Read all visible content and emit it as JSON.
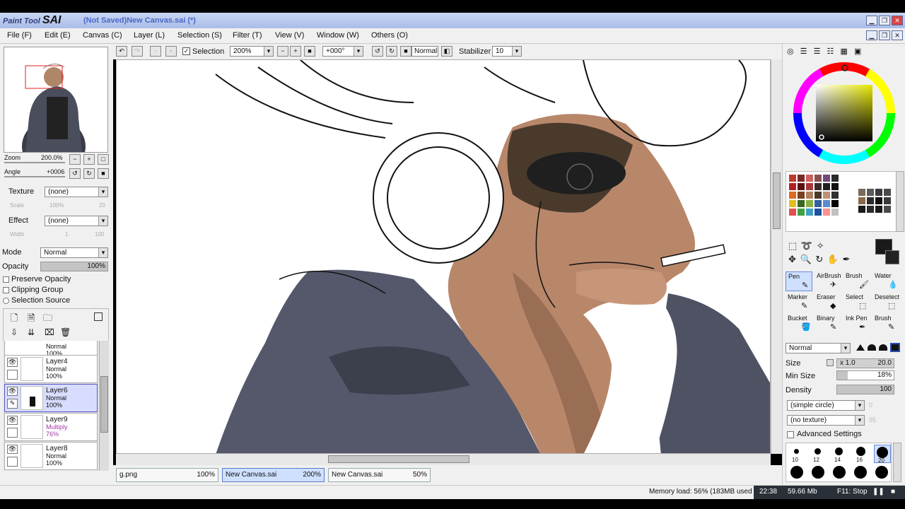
{
  "titlebar": {
    "logo_small": "Paint Tool",
    "logo_big": "SAI",
    "title": "(Not Saved)New Canvas.sai (*)"
  },
  "menu": [
    "File (F)",
    "Edit (E)",
    "Canvas (C)",
    "Layer (L)",
    "Selection (S)",
    "Filter (T)",
    "View (V)",
    "Window (W)",
    "Others (O)"
  ],
  "toolbar": {
    "selection_label": "Selection",
    "zoom": "200%",
    "angle": "+000°",
    "mode": "Normal",
    "stabilizer_label": "Stabilizer",
    "stabilizer_value": "10"
  },
  "navigator": {
    "zoom_label": "Zoom",
    "zoom_value": "200.0%",
    "angle_label": "Angle",
    "angle_value": "+0006"
  },
  "layer_props": {
    "texture_label": "Texture",
    "texture_value": "(none)",
    "scale_label": "Scale",
    "scale_value": "100%",
    "scale_num": "20",
    "effect_label": "Effect",
    "effect_value": "(none)",
    "width_label": "Width",
    "width_value": "1",
    "width_num": "100",
    "mode_label": "Mode",
    "mode_value": "Normal",
    "opacity_label": "Opacity",
    "opacity_value": "100%",
    "preserve_opacity": "Preserve Opacity",
    "clipping_group": "Clipping Group",
    "selection_source": "Selection Source"
  },
  "layers": [
    {
      "name": "Layer4",
      "mode": "Normal",
      "opacity": "100%",
      "active": false
    },
    {
      "name": "Layer6",
      "mode": "Normal",
      "opacity": "100%",
      "active": true
    },
    {
      "name": "Layer9",
      "mode": "Multiply",
      "opacity": "76%",
      "active": false
    },
    {
      "name": "Layer8",
      "mode": "Normal",
      "opacity": "100%",
      "active": false
    }
  ],
  "layer_top_partial": {
    "mode": "Normal",
    "opacity": "100%"
  },
  "tabs": [
    {
      "name": "g.png",
      "zoom": "100%"
    },
    {
      "name": "New Canvas.sai",
      "zoom": "200%"
    },
    {
      "name": "New Canvas.sai",
      "zoom": "50%"
    }
  ],
  "tools": [
    {
      "label": "Pen"
    },
    {
      "label": "AirBrush"
    },
    {
      "label": "Brush"
    },
    {
      "label": "Water"
    },
    {
      "label": "Marker"
    },
    {
      "label": "Eraser"
    },
    {
      "label": "Select"
    },
    {
      "label": "Deselect"
    },
    {
      "label": "Bucket"
    },
    {
      "label": "Binary"
    },
    {
      "label": "Ink Pen"
    },
    {
      "label": "Brush"
    }
  ],
  "brush": {
    "mode": "Normal",
    "size_label": "Size",
    "size_mult": "x 1.0",
    "size_value": "20.0",
    "minsize_label": "Min Size",
    "minsize_value": "18%",
    "density_label": "Density",
    "density_value": "100",
    "shape": "(simple circle)",
    "shape_num": "0",
    "texture": "(no texture)",
    "texture_num": "95",
    "advanced": "Advanced Settings",
    "sizes": [
      "10",
      "12",
      "14",
      "16",
      "20"
    ]
  },
  "status": {
    "memory": "Memory load: 56% (183MB used",
    "time": "22:38",
    "filesize": "59.66 Mb",
    "recorder": "F11: Stop"
  },
  "colors": {
    "swatches": [
      "#c0392b",
      "#7b2a2a",
      "#d06060",
      "#8a5050",
      "#704a7a",
      "#2a2a2a",
      "#b02020",
      "#5a1010",
      "#a83838",
      "#3a2a2a",
      "#202020",
      "#101010",
      "#e06a20",
      "#7a4020",
      "#b08060",
      "#4a3a2a",
      "#c09070",
      "#303030",
      "#e0c020",
      "#3a6a20",
      "#8ab040",
      "#3060a0",
      "#5a8ad0",
      "#000000",
      "#e05050",
      "#40a040",
      "#40a0c0",
      "#2050a0",
      "#ff9090",
      "#c0c0c0"
    ],
    "swatches_right": [
      "#7a6a5a",
      "#5a5a5a",
      "#3a3a3a",
      "#4a4a4a",
      "#8a6a4a",
      "#2a2a2a",
      "#101010",
      "#3a3a3a",
      "#1a1a1a",
      "#2a2a2a",
      "#1a1a1a",
      "#4a4a4a"
    ]
  }
}
